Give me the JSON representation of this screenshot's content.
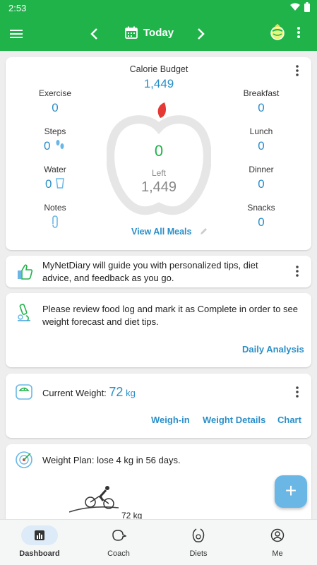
{
  "status_bar": {
    "time": "2:53"
  },
  "app_bar": {
    "date_label": "Today"
  },
  "calorie_card": {
    "title": "Calorie Budget",
    "budget": "1,449",
    "left_value": "0",
    "left_label": "Left",
    "left_calories": "1,449",
    "exercise": {
      "label": "Exercise",
      "value": "0"
    },
    "steps": {
      "label": "Steps",
      "value": "0"
    },
    "water": {
      "label": "Water",
      "value": "0"
    },
    "notes": {
      "label": "Notes"
    },
    "breakfast": {
      "label": "Breakfast",
      "value": "0"
    },
    "lunch": {
      "label": "Lunch",
      "value": "0"
    },
    "dinner": {
      "label": "Dinner",
      "value": "0"
    },
    "snacks": {
      "label": "Snacks",
      "value": "0"
    },
    "view_all_meals": "View All Meals"
  },
  "tip_card": {
    "text": "MyNetDiary will guide you with personalized tips, diet advice, and feedback as you go."
  },
  "review_card": {
    "text": "Please review food log and mark it as Complete in order to see weight forecast and diet tips.",
    "link": "Daily Analysis"
  },
  "weight_card": {
    "label": "Current Weight:",
    "value": "72",
    "unit": "kg",
    "actions": [
      "Weigh-in",
      "Weight Details",
      "Chart"
    ]
  },
  "plan_card": {
    "text": "Weight Plan: lose 4 kg in 56 days.",
    "partial_value": "72 kg"
  },
  "fab": {
    "label": "+"
  },
  "bottom_nav": [
    {
      "label": "Dashboard",
      "active": true
    },
    {
      "label": "Coach",
      "active": false
    },
    {
      "label": "Diets",
      "active": false
    },
    {
      "label": "Me",
      "active": false
    }
  ],
  "colors": {
    "brand_green": "#1fb34a",
    "link_blue": "#2a8fc8",
    "fab_blue": "#6ab7e6",
    "apple_red": "#e53935"
  }
}
